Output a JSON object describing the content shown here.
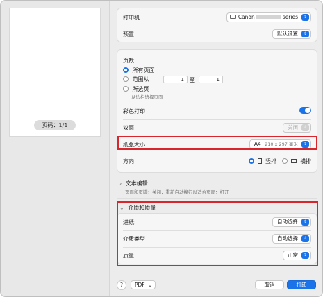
{
  "preview": {
    "page_count": "页码：1/1"
  },
  "printer": {
    "label": "打印机",
    "value_prefix": "Canon",
    "value_suffix": "series"
  },
  "presets": {
    "label": "预置",
    "value": "默认设置"
  },
  "pages": {
    "title": "页数",
    "all": "所有页面",
    "range": "范围从",
    "from": "1",
    "to_label": "至",
    "to": "1",
    "selected": "所选页",
    "selected_hint": "从边栏选择页面"
  },
  "color_print": {
    "label": "彩色打印"
  },
  "duplex": {
    "label": "双面",
    "value": "关闭"
  },
  "paper_size": {
    "label": "纸张大小",
    "value": "A4",
    "detail": "210 x 297 毫米"
  },
  "orientation": {
    "label": "方向",
    "portrait": "竖排",
    "landscape": "横排"
  },
  "text_edit": {
    "title": "文本编辑",
    "desc": "页眉和页脚：关闭，重新自动换行以适合页面：打开"
  },
  "media_quality": {
    "title": "介质和质量",
    "feed": {
      "label": "进纸:",
      "value": "自动选择"
    },
    "media": {
      "label": "介质类型",
      "value": "自动选择"
    },
    "quality": {
      "label": "质量",
      "value": "正常"
    }
  },
  "footer": {
    "help": "?",
    "pdf": "PDF",
    "cancel": "取消",
    "print": "打印"
  },
  "colors": {
    "accent": "#1a73e8",
    "highlight": "#d9262c"
  }
}
